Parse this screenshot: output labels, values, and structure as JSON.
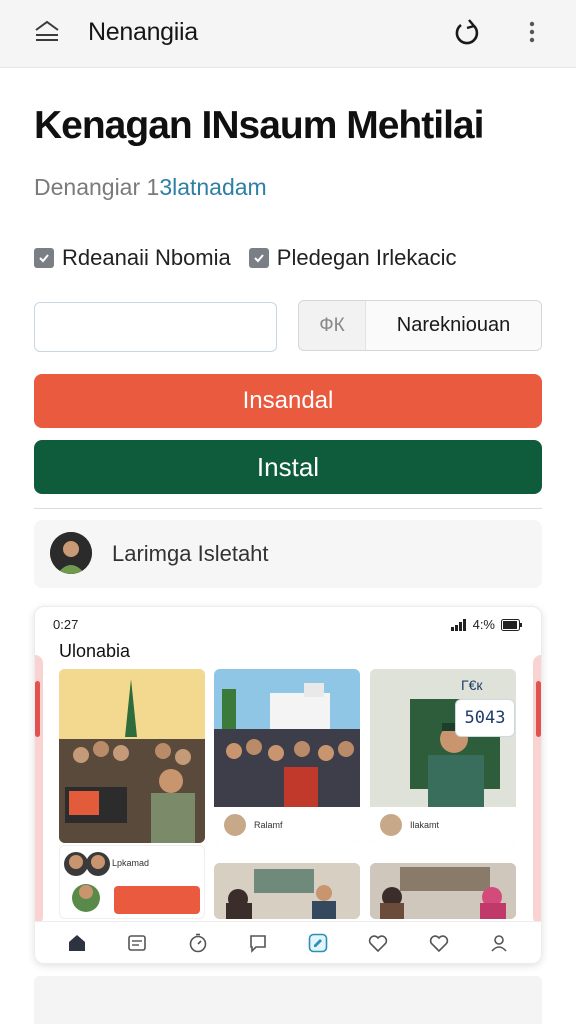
{
  "app": {
    "title": "Nenangiia"
  },
  "main": {
    "headline": "Kenagan INsaum Mehtilai",
    "subhead_main": "Denangiar 1",
    "subhead_accent": "3latnadam",
    "checkboxes": [
      {
        "label": "Rdeanaii Nbomia",
        "checked": true
      },
      {
        "label": "Pledegan Irlekacic",
        "checked": true
      }
    ],
    "input": {
      "value": "",
      "placeholder": ""
    },
    "segment": {
      "ok_label": "ФК",
      "option_label": "Narekniouan"
    },
    "primary_button": "Insandal",
    "install_button": "Instal",
    "profile_name": "Larimga Isletaht"
  },
  "preview": {
    "time": "0:27",
    "signal_text": "4:%",
    "title": "Ulonabia",
    "tag": "Г€к",
    "price": "5043",
    "captions": [
      "Ralamf",
      "Ilakamt",
      "Lpkamad"
    ]
  },
  "nav": {
    "items": [
      {
        "icon": "home-icon"
      },
      {
        "icon": "news-icon"
      },
      {
        "icon": "timer-icon"
      },
      {
        "icon": "chat-icon"
      },
      {
        "icon": "edit-icon"
      },
      {
        "icon": "heart-icon"
      },
      {
        "icon": "heart-outline-icon"
      },
      {
        "icon": "profile-icon"
      }
    ]
  },
  "colors": {
    "primary_orange": "#ea5a3e",
    "install_green": "#0f5c3d",
    "accent_blue": "#2d7fa6"
  }
}
